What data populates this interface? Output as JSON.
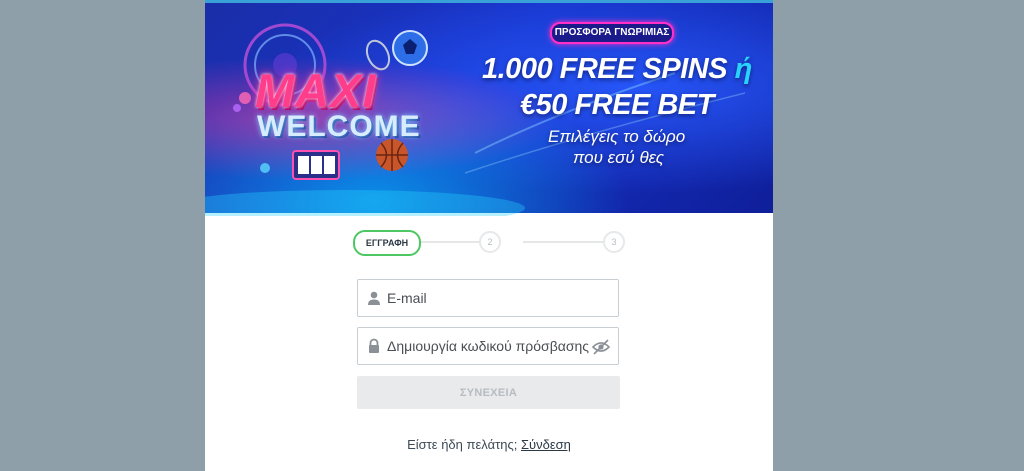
{
  "banner": {
    "promo_badge": "ΠΡΟΣΦΟΡΑ ΓΝΩΡΙΜΙΑΣ",
    "logo_line1": "MAXI",
    "logo_line2": "WELCOME",
    "offer_line1": "1.000 FREE SPINS",
    "offer_line1_accent": "ή",
    "offer_line2": "€50 FREE BET",
    "tagline_line1": "Επιλέγεις το δώρο",
    "tagline_line2": "που εσύ θες"
  },
  "stepper": {
    "active_label": "ΕΓΓΡΑΦΗ",
    "step2": "2",
    "step3": "3"
  },
  "form": {
    "email_placeholder": "E-mail",
    "email_value": "",
    "password_placeholder": "Δημιουργία κωδικού πρόσβασης",
    "password_value": "",
    "continue_label": "ΣΥΝΕΧΕΙΑ"
  },
  "footer": {
    "existing_customer_text": "Είστε ήδη πελάτης;",
    "login_link": "Σύνδεση"
  },
  "colors": {
    "backdrop": "#8f9fa9",
    "active_step": "#4cc764",
    "banner_blue": "#1733c9",
    "promo_pink": "#ff2fc8"
  },
  "icons": {
    "email_field": "user-icon",
    "password_field": "lock-icon",
    "visibility_toggle": "eye-off-icon"
  }
}
